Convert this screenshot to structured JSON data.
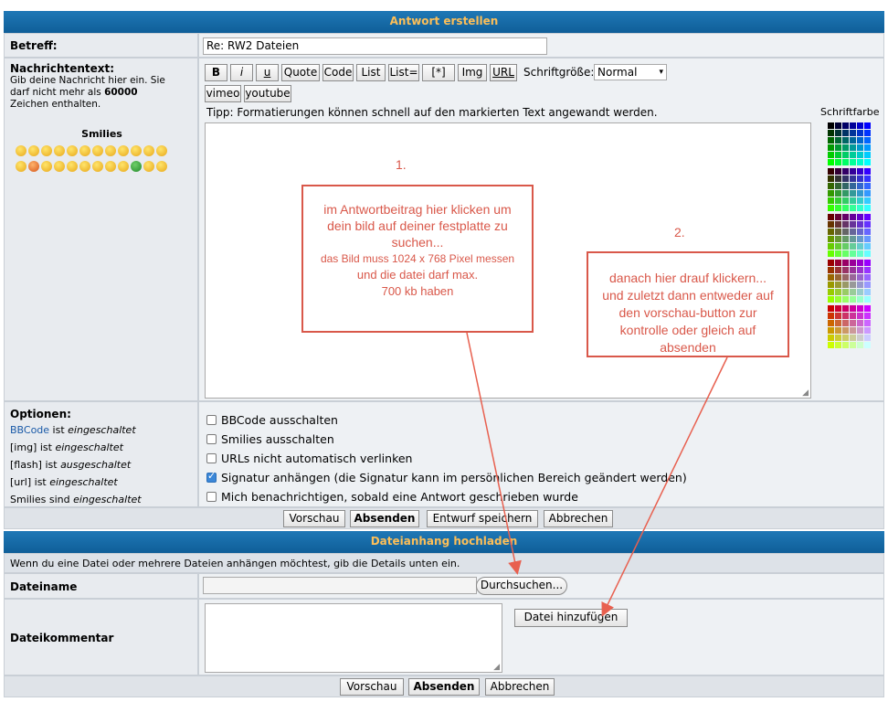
{
  "header": {
    "title": "Antwort erstellen"
  },
  "subject": {
    "label": "Betreff:",
    "value": "Re: RW2 Dateien"
  },
  "message": {
    "label": "Nachrichtentext:",
    "hint_part1": "Gib deine Nachricht hier ein. Sie darf nicht mehr als ",
    "hint_limit": "60000",
    "hint_part2": " Zeichen enthalten.",
    "smilies_title": "Smilies",
    "tip": "Tipp: Formatierungen können schnell auf den markierten Text angewandt werden.",
    "font_size_label": "Schriftgröße:",
    "font_size_value": "Normal",
    "font_color_label": "Schriftfarbe"
  },
  "toolbar": {
    "buttons": [
      "B",
      "i",
      "u",
      "Quote",
      "Code",
      "List",
      "List=",
      "[*]",
      "Img",
      "URL"
    ],
    "buttons_row2": [
      "vimeo",
      "youtube"
    ]
  },
  "options": {
    "title": "Optionen:",
    "status": [
      {
        "key": "BBCode",
        "text": " ist ",
        "state": "eingeschaltet"
      },
      {
        "key": "[img]",
        "text": " ist ",
        "state": "eingeschaltet"
      },
      {
        "key": "[flash]",
        "text": " ist ",
        "state": "ausgeschaltet"
      },
      {
        "key": "[url]",
        "text": " ist ",
        "state": "eingeschaltet"
      },
      {
        "key": "Smilies",
        "text": " sind ",
        "state": "eingeschaltet"
      }
    ],
    "checkboxes": [
      {
        "label": "BBCode ausschalten",
        "checked": false
      },
      {
        "label": "Smilies ausschalten",
        "checked": false
      },
      {
        "label": "URLs nicht automatisch verlinken",
        "checked": false
      },
      {
        "label": "Signatur anhängen (die Signatur kann im persönlichen Bereich geändert werden)",
        "checked": true
      },
      {
        "label": "Mich benachrichtigen, sobald eine Antwort geschrieben wurde",
        "checked": false
      }
    ]
  },
  "actions": {
    "preview": "Vorschau",
    "submit": "Absenden",
    "draft": "Entwurf speichern",
    "cancel": "Abbrechen"
  },
  "attachment": {
    "header": "Dateianhang hochladen",
    "info": "Wenn du eine Datei oder mehrere Dateien anhängen möchtest, gib die Details unten ein.",
    "filename_label": "Dateiname",
    "browse_label": "Durchsuchen...",
    "comment_label": "Dateikommentar",
    "add_file_label": "Datei hinzufügen"
  },
  "annotations": {
    "step1_number": "1.",
    "step1_lines": [
      "im Antwortbeitrag hier klicken um",
      "dein bild auf deiner festplatte zu",
      "suchen...",
      "das Bild muss 1024 x 768 Pixel messen",
      "und die datei darf max.",
      "700 kb haben"
    ],
    "step2_number": "2.",
    "step2_lines": [
      "danach hier drauf klickern...",
      "und zuletzt dann entweder auf",
      "den vorschau-button zur",
      "kontrolle oder gleich auf",
      "absenden"
    ],
    "color": "#d9584a"
  },
  "colors": {
    "header_bg": "#1667a6",
    "header_text": "#fdbf58",
    "row_bg": "#e8ebef"
  }
}
